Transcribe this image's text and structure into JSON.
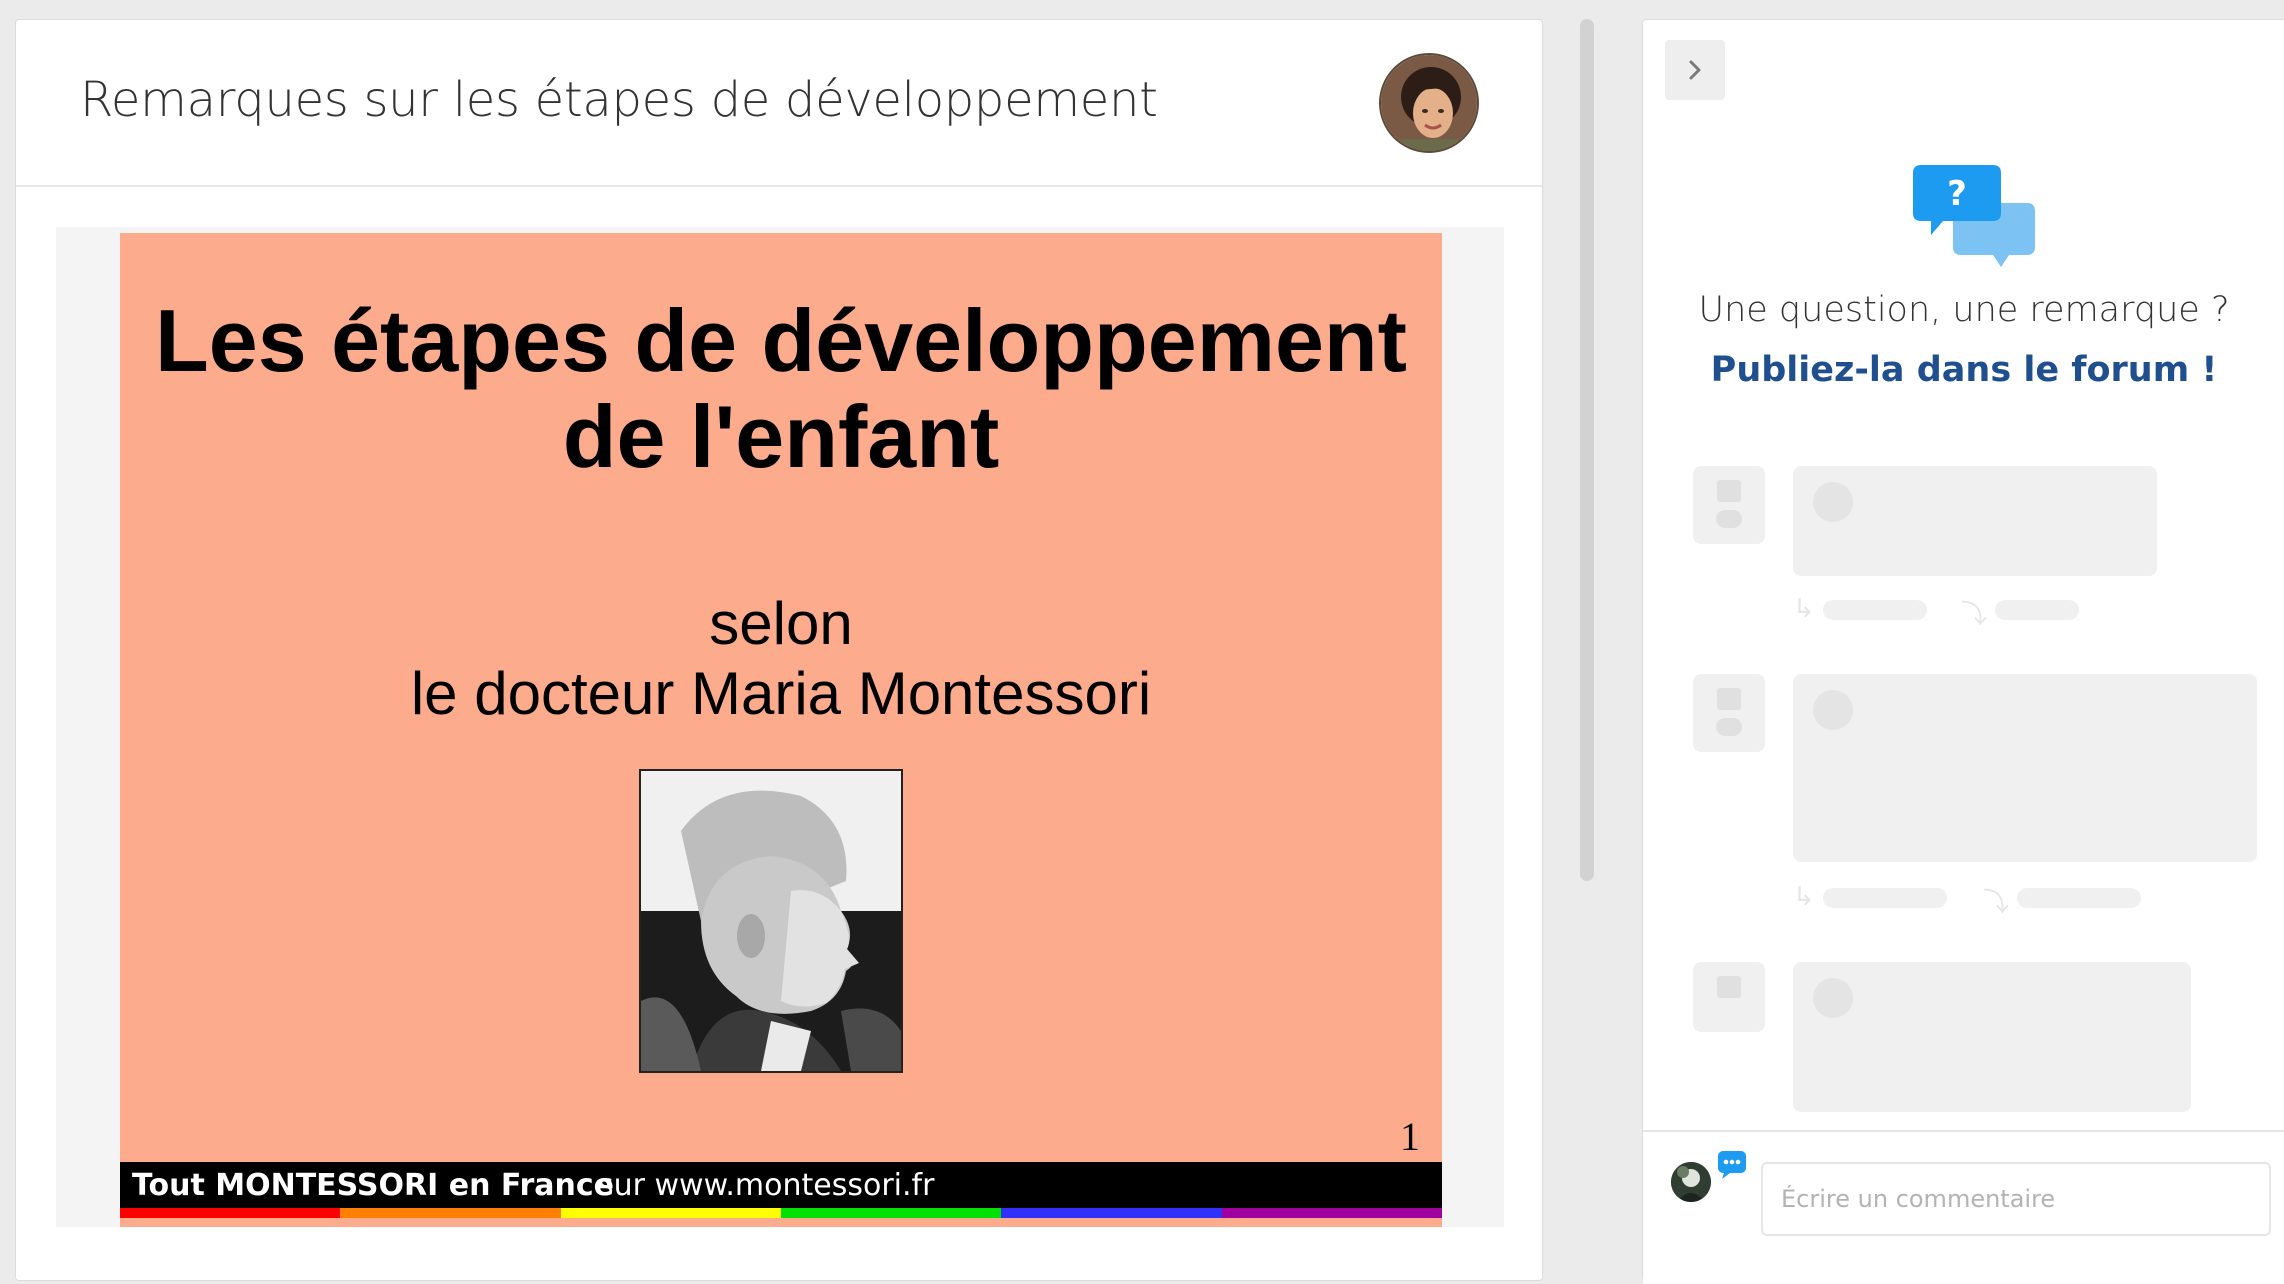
{
  "lesson": {
    "title": "Remarques sur les étapes de développement"
  },
  "slide": {
    "title_line1": "Les étapes de développement",
    "title_line2": "de l'enfant",
    "subtitle_line1": "selon",
    "subtitle_line2": "le docteur Maria Montessori",
    "page_number": "1",
    "footer_brand": "Tout MONTESSORI en France",
    "footer_url": "sur www.montessori.fr",
    "rainbow_colors": [
      "#ff0000",
      "#ff8000",
      "#ffff00",
      "#00e000",
      "#3030ff",
      "#a000a0"
    ]
  },
  "forum": {
    "collapse_icon": "chevron-right-icon",
    "question": "Une question, une remarque ?",
    "cta": "Publiez-la dans le forum !",
    "comment_placeholder": "Écrire un commentaire",
    "comment_value": ""
  },
  "colors": {
    "accent": "#1f4f8e",
    "icon_blue": "#1d9bf0",
    "slide_bg": "#fcab8d"
  }
}
